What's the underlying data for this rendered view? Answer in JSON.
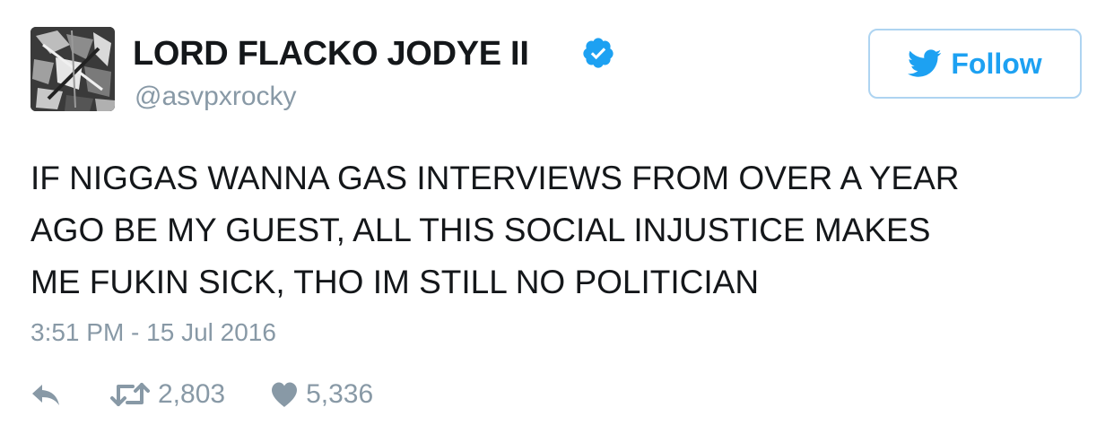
{
  "author": {
    "name": "LORD FLACKO JODYE II",
    "handle": "@asvpxrocky",
    "verified": true,
    "avatar_icon": "profile-photo"
  },
  "follow_button": {
    "label": "Follow",
    "icon": "twitter-bird-icon"
  },
  "tweet": {
    "text": "IF NIGGAS WANNA GAS INTERVIEWS FROM OVER A YEAR\nAGO BE MY GUEST, ALL THIS SOCIAL INJUSTICE MAKES\nME FUKIN SICK, THO IM STILL NO POLITICIAN",
    "timestamp": "3:51 PM - 15 Jul 2016"
  },
  "actions": {
    "retweets": "2,803",
    "likes": "5,336"
  },
  "colors": {
    "accent": "#1da1f2",
    "muted": "#8899a6",
    "text": "#14171a",
    "verified": "#1da1f2"
  }
}
